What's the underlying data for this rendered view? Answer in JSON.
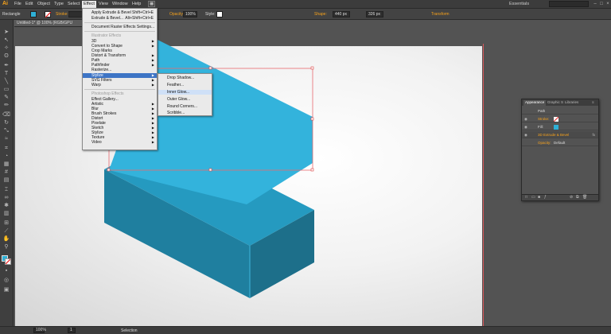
{
  "app": {
    "logo": "Ai",
    "workspace": "Essentials"
  },
  "menubar": {
    "items": [
      "File",
      "Edit",
      "Object",
      "Type",
      "Select",
      "Effect",
      "View",
      "Window",
      "Help"
    ],
    "active": "Effect"
  },
  "control_bar": {
    "selection_label": "Rectangle",
    "stroke_label": "Stroke:",
    "opacity_label": "Opacity:",
    "opacity_value": "100%",
    "style_label": "Style:",
    "shape_label": "Shape:",
    "width_value": "440 px",
    "height_value": "326 px",
    "transform_label": "Transform"
  },
  "document_tab": "Untitled-1* @ 100% (RGB/GPU Preview)",
  "effect_menu": {
    "apply_last": "Apply Extrude & Bevel",
    "apply_last_shortcut": "Shift+Ctrl+E",
    "last_effect": "Extrude & Bevel...",
    "last_effect_shortcut": "Alt+Shift+Ctrl+E",
    "raster_settings": "Document Raster Effects Settings...",
    "illustrator_header": "Illustrator Effects",
    "illustrator_items": [
      "3D",
      "Convert to Shape",
      "Crop Marks",
      "Distort & Transform",
      "Path",
      "Pathfinder",
      "Rasterize...",
      "Stylize",
      "SVG Filters",
      "Warp"
    ],
    "photoshop_header": "Photoshop Effects",
    "photoshop_items": [
      "Effect Gallery...",
      "Artistic",
      "Blur",
      "Brush Strokes",
      "Distort",
      "Pixelate",
      "Sketch",
      "Stylize",
      "Texture",
      "Video"
    ]
  },
  "stylize_submenu": {
    "items": [
      "Drop Shadow...",
      "Feather...",
      "Inner Glow...",
      "Outer Glow...",
      "Round Corners...",
      "Scribble..."
    ],
    "highlighted": "Inner Glow..."
  },
  "appearance_panel": {
    "tabs": [
      "Appearance",
      "Graphic S",
      "Libraries"
    ],
    "object": "Path",
    "stroke_label": "Stroke:",
    "fill_label": "Fill:",
    "effect": "3D Extrude & Bevel",
    "opacity_label": "Opacity:",
    "opacity_value": "Default",
    "fx_icon": "fx"
  },
  "status_bar": {
    "zoom": "100%",
    "page": "1",
    "tool": "Selection"
  },
  "colors": {
    "fill": "#2fb0d6",
    "menu_highlight": "#3d74c5",
    "accent_orange": "#f7a21b",
    "guide_red": "#d8575a"
  }
}
